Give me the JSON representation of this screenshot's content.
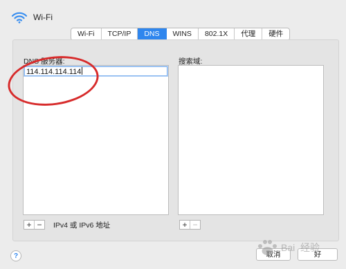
{
  "header": {
    "title": "Wi-Fi",
    "icon": "wifi-icon"
  },
  "tabs": [
    {
      "label": "Wi-Fi",
      "active": false
    },
    {
      "label": "TCP/IP",
      "active": false
    },
    {
      "label": "DNS",
      "active": true
    },
    {
      "label": "WINS",
      "active": false
    },
    {
      "label": "802.1X",
      "active": false
    },
    {
      "label": "代理",
      "active": false
    },
    {
      "label": "硬件",
      "active": false
    }
  ],
  "dns": {
    "label": "DNS 服务器:",
    "servers": [
      "114.114.114.114"
    ],
    "hint": "IPv4 或 IPv6 地址"
  },
  "search_domains": {
    "label": "搜索域:",
    "items": []
  },
  "buttons": {
    "plus": "+",
    "minus": "−",
    "cancel": "取消",
    "ok": "好",
    "help": "?"
  },
  "colors": {
    "accent": "#2f86ee",
    "annotation": "#d72b2b"
  }
}
